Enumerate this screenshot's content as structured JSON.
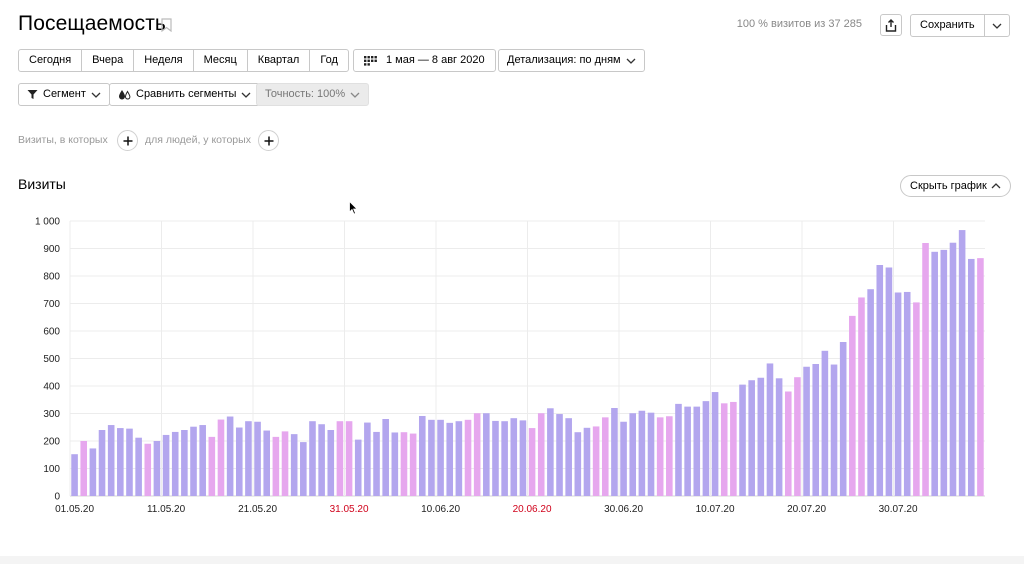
{
  "header": {
    "title": "Посещаемость",
    "visits_info": "100 % визитов из 37 285",
    "save_label": "Сохранить"
  },
  "periods": [
    "Сегодня",
    "Вчера",
    "Неделя",
    "Месяц",
    "Квартал",
    "Год"
  ],
  "date_range": "1 мая — 8 авг 2020",
  "detail": "Детализация: по дням",
  "segment_label": "Сегмент",
  "compare_label": "Сравнить сегменты",
  "accuracy_label": "Точность: 100%",
  "conditions": {
    "visits_label": "Визиты, в которых",
    "people_label": "для людей, у которых"
  },
  "section_title": "Визиты",
  "hide_chart_label": "Скрыть график",
  "colors": {
    "weekday": "#b3a6ee",
    "weekend": "#e6a7ee",
    "red_label": "#d0021b"
  },
  "chart_data": {
    "type": "bar",
    "ylim": [
      0,
      1000
    ],
    "yticks": [
      "0",
      "100",
      "200",
      "300",
      "400",
      "500",
      "600",
      "700",
      "800",
      "900",
      "1 000"
    ],
    "xticks": [
      {
        "label": "01.05.20",
        "index": 0,
        "red": false
      },
      {
        "label": "11.05.20",
        "index": 10,
        "red": false
      },
      {
        "label": "21.05.20",
        "index": 20,
        "red": false
      },
      {
        "label": "31.05.20",
        "index": 30,
        "red": true
      },
      {
        "label": "10.06.20",
        "index": 40,
        "red": false
      },
      {
        "label": "20.06.20",
        "index": 50,
        "red": true
      },
      {
        "label": "30.06.20",
        "index": 60,
        "red": false
      },
      {
        "label": "10.07.20",
        "index": 70,
        "red": false
      },
      {
        "label": "20.07.20",
        "index": 80,
        "red": false
      },
      {
        "label": "30.07.20",
        "index": 90,
        "red": false
      }
    ],
    "values": [
      152,
      200,
      173,
      240,
      258,
      247,
      245,
      212,
      190,
      200,
      222,
      233,
      240,
      252,
      258,
      215,
      278,
      289,
      249,
      272,
      270,
      238,
      215,
      235,
      225,
      196,
      272,
      261,
      240,
      272,
      272,
      205,
      267,
      233,
      280,
      231,
      232,
      227,
      291,
      277,
      277,
      266,
      272,
      277,
      301,
      301,
      273,
      272,
      283,
      275,
      247,
      301,
      319,
      298,
      283,
      232,
      248,
      253,
      286,
      320,
      270,
      301,
      310,
      303,
      286,
      290,
      335,
      325,
      325,
      345,
      378,
      337,
      342,
      405,
      421,
      430,
      482,
      428,
      380,
      432,
      470,
      480,
      528,
      478,
      560,
      655,
      722,
      752,
      840,
      831,
      740,
      742,
      704,
      920,
      888,
      895,
      921,
      967,
      862,
      865
    ],
    "weekend": [
      false,
      true,
      false,
      false,
      false,
      false,
      false,
      false,
      true,
      false,
      false,
      false,
      false,
      false,
      false,
      true,
      true,
      false,
      false,
      false,
      false,
      false,
      true,
      true,
      false,
      false,
      false,
      false,
      false,
      true,
      true,
      false,
      false,
      false,
      false,
      false,
      true,
      true,
      false,
      false,
      false,
      false,
      false,
      true,
      true,
      false,
      false,
      false,
      false,
      false,
      true,
      true,
      false,
      false,
      false,
      false,
      false,
      true,
      true,
      false,
      false,
      false,
      false,
      false,
      true,
      true,
      false,
      false,
      false,
      false,
      false,
      true,
      true,
      false,
      false,
      false,
      false,
      false,
      true,
      true,
      false,
      false,
      false,
      false,
      false,
      true,
      true,
      false,
      false,
      false,
      false,
      false,
      true,
      true,
      false,
      false,
      false,
      false,
      false,
      true
    ]
  }
}
